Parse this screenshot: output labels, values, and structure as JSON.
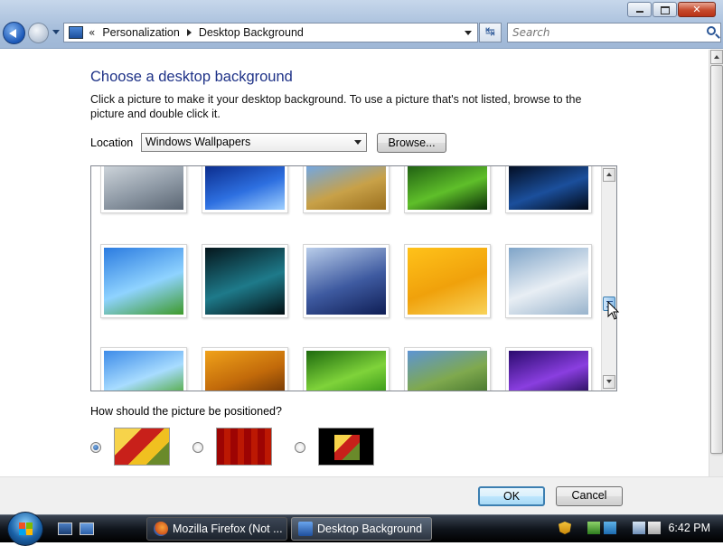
{
  "window": {
    "breadcrumb_overflow": "«",
    "breadcrumb": [
      "Personalization",
      "Desktop Background"
    ],
    "search_placeholder": "Search",
    "refresh_icon": "refresh-icon"
  },
  "content": {
    "heading": "Choose a desktop background",
    "description": "Click a picture to make it your desktop background. To use a picture that's not listed, browse to the picture and double click it.",
    "location_label": "Location",
    "location_value": "Windows Wallpapers",
    "browse_label": "Browse...",
    "position_question": "How should the picture be positioned?"
  },
  "wallpapers": [
    {
      "name": "wallpaper-glass-tiles",
      "colors": [
        "#cfd6dc",
        "#8e99a5",
        "#5a6572"
      ]
    },
    {
      "name": "wallpaper-blue-streak",
      "colors": [
        "#0a2a8a",
        "#2d6fe0",
        "#9fd0ff"
      ]
    },
    {
      "name": "wallpaper-wheat-field",
      "colors": [
        "#6fa7e8",
        "#c8a148",
        "#9a6f1e"
      ]
    },
    {
      "name": "wallpaper-green-drop",
      "colors": [
        "#1e5d12",
        "#5fbf2a",
        "#0b2e08"
      ]
    },
    {
      "name": "wallpaper-windows10-dark",
      "colors": [
        "#020b1e",
        "#1b4f9c",
        "#020814"
      ]
    },
    {
      "name": "wallpaper-bliss-reflection",
      "colors": [
        "#2b7be0",
        "#8fd3ff",
        "#3e9a2a"
      ]
    },
    {
      "name": "wallpaper-dark-light-rays",
      "colors": [
        "#05161c",
        "#1e7a8a",
        "#031014"
      ]
    },
    {
      "name": "wallpaper-mount-fuji",
      "colors": [
        "#b9cdea",
        "#3e5aa0",
        "#0f1e55"
      ]
    },
    {
      "name": "wallpaper-orange-abstract",
      "colors": [
        "#ffc21a",
        "#f0a10b",
        "#f8d35a"
      ]
    },
    {
      "name": "wallpaper-snowy-mountains",
      "colors": [
        "#7fa4c8",
        "#e8eef4",
        "#98b3cc"
      ]
    },
    {
      "name": "wallpaper-bliss",
      "colors": [
        "#3d8be8",
        "#a8dcff",
        "#4aa52a"
      ]
    },
    {
      "name": "wallpaper-honeycomb",
      "colors": [
        "#f0a21a",
        "#c26a0a",
        "#6a3205"
      ]
    },
    {
      "name": "wallpaper-green-glow",
      "colors": [
        "#1d6a0e",
        "#7fd33a",
        "#2e8f14"
      ]
    },
    {
      "name": "wallpaper-tree",
      "colors": [
        "#5d94d4",
        "#7fa94e",
        "#3f6f2a"
      ]
    },
    {
      "name": "wallpaper-purple-aurora",
      "colors": [
        "#2a0b6e",
        "#8a3ee0",
        "#1a0848"
      ]
    }
  ],
  "positions": [
    {
      "name": "position-fill",
      "selected": true
    },
    {
      "name": "position-tile",
      "selected": false
    },
    {
      "name": "position-center",
      "selected": false
    }
  ],
  "buttons": {
    "ok": "OK",
    "cancel": "Cancel"
  },
  "taskbar": {
    "tasks": [
      {
        "label": "Mozilla Firefox (Not ...",
        "icon": "firefox-icon"
      },
      {
        "label": "Desktop Background",
        "icon": "control-panel-icon",
        "active": true
      }
    ],
    "clock": "6:42 PM"
  },
  "colors": {
    "heading": "#1e3287",
    "accent": "#3c7fb1"
  }
}
